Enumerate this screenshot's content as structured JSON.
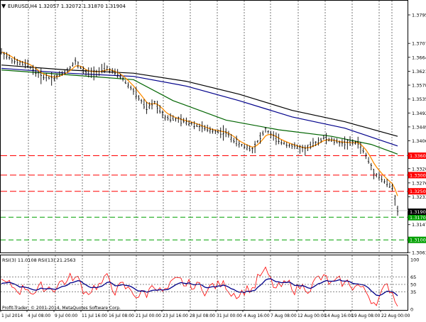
{
  "header": {
    "symbol_line": "EURUSD,H4  1.32057 1.32072 1.31870 1.31904",
    "arrow_glyph": "▼"
  },
  "price_axis": {
    "ticks": [
      "1.37950",
      "1.37070",
      "1.36640",
      "1.36210",
      "1.35780",
      "1.35350",
      "1.34920",
      "1.34490",
      "1.34060",
      "1.33200",
      "1.32760",
      "1.32330",
      "1.31470",
      "1.30610"
    ]
  },
  "levels": [
    {
      "label": "1.33600",
      "value": 1.336,
      "style": "red"
    },
    {
      "label": "1.33000",
      "value": 1.33,
      "style": "red"
    },
    {
      "label": "1.32500",
      "value": 1.325,
      "style": "red"
    },
    {
      "label": "1.31700",
      "value": 1.317,
      "style": "green"
    },
    {
      "label": "1.31000",
      "value": 1.31,
      "style": "green"
    }
  ],
  "current_price": {
    "label": "1.31904",
    "value": 1.31904
  },
  "rsi_panel": {
    "title": "RSI(3) 11.0108  RSI(13) 21.2563",
    "ticks": [
      "100",
      "65",
      "50",
      "35",
      "0"
    ],
    "credit": "Profit-Trader, © 2001-2014, MetaQuotes Software Corp."
  },
  "time_axis": {
    "labels": [
      "1 Jul 2014",
      "4 Jul 08:00",
      "9 Jul 00:00",
      "11 Jul 16:00",
      "16 Jul 08:00",
      "21 Jul 00:00",
      "23 Jul 16:00",
      "28 Jul 08:00",
      "31 Jul 00:00",
      "4 Aug 16:00",
      "7 Aug 08:00",
      "12 Aug 00:00",
      "14 Aug 16:00",
      "19 Aug 08:00",
      "22 Aug 00:00"
    ]
  },
  "colors": {
    "ema_fast": "#ff8c00",
    "ma_green": "#006400",
    "ma_blue": "#00008b",
    "ma_black": "#000000",
    "rsi_fast": "#ff0000",
    "rsi_slow": "#00008b",
    "level_red": "#ff0000",
    "level_green": "#00a000"
  },
  "chart_data": {
    "type": "line",
    "x": [
      0,
      10,
      20,
      30,
      40,
      50,
      60,
      70,
      80,
      90,
      100,
      110,
      120,
      130,
      140,
      150
    ],
    "series": [
      {
        "values": [
          1.367,
          1.363,
          1.36,
          1.362,
          1.361,
          1.363,
          1.362,
          1.356,
          1.35,
          1.347,
          1.345,
          1.344,
          1.343,
          1.342,
          1.34,
          1.337
        ]
      },
      {
        "values": [
          1.364,
          1.363,
          1.362,
          1.362,
          1.361,
          1.36,
          1.358,
          1.356,
          1.354,
          1.352,
          1.35,
          1.349,
          1.348,
          1.347,
          1.346,
          1.344
        ]
      }
    ]
  }
}
